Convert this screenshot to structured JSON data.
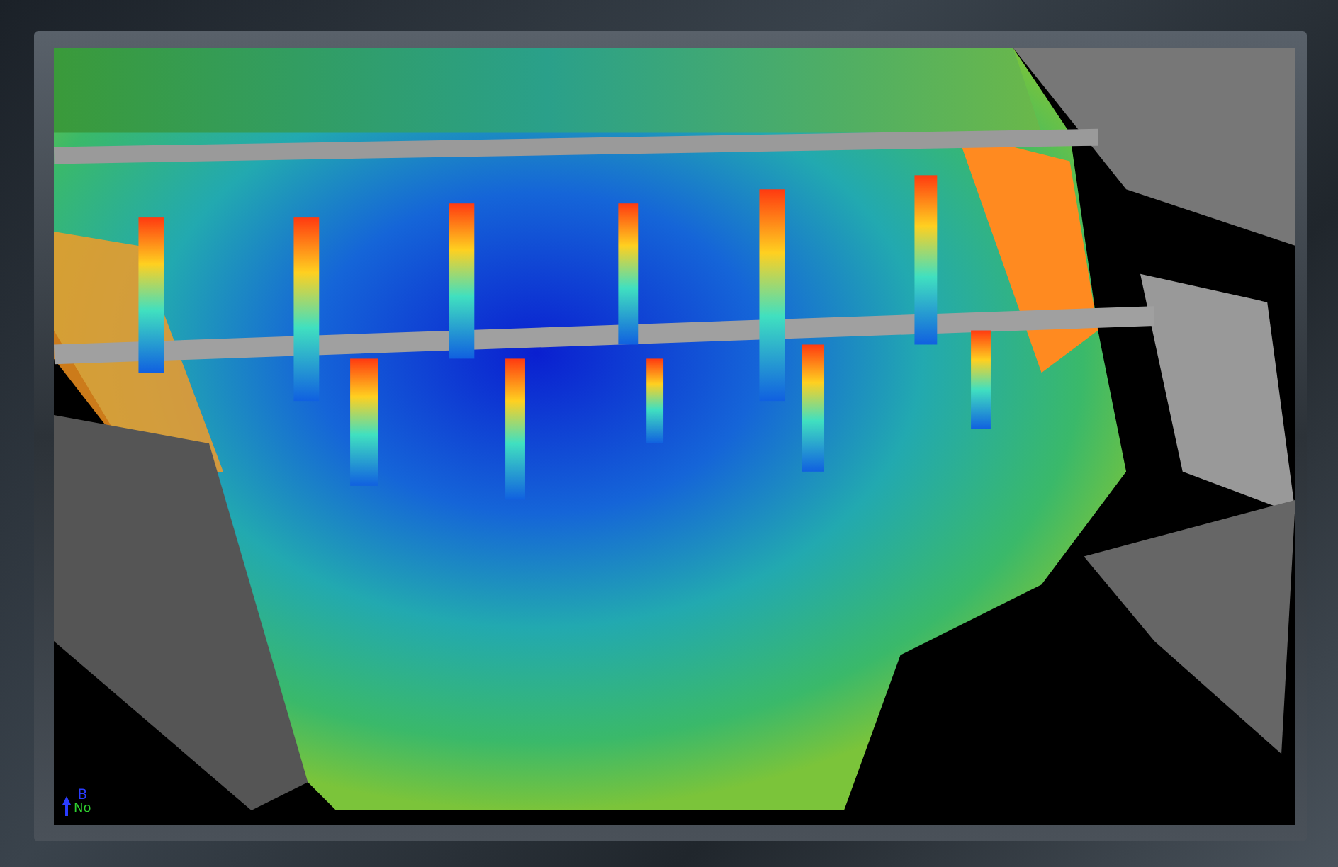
{
  "viewport": {
    "axis_labels": [
      "B",
      "No"
    ]
  }
}
